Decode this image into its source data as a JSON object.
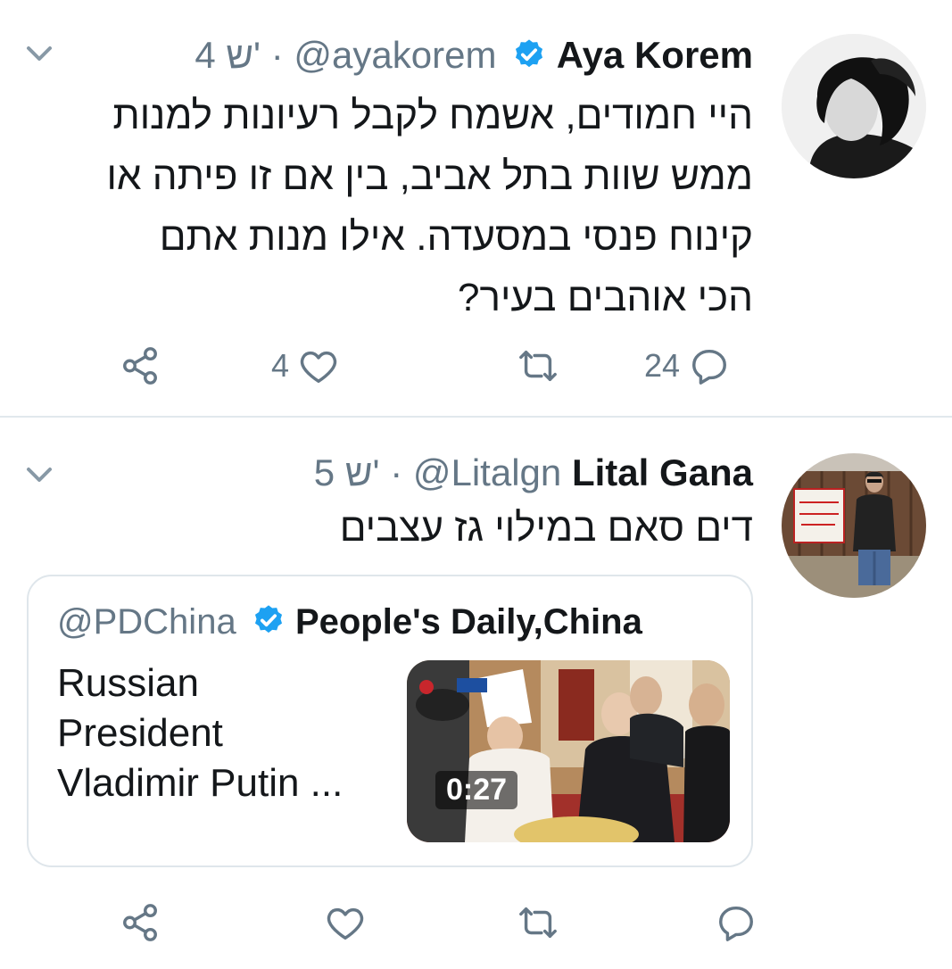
{
  "tweets": [
    {
      "name": "Aya Korem",
      "handle": "@ayakorem",
      "dot": "·",
      "time": "4 ש'",
      "text_lines": [
        "היי חמודים, אשמח לקבל רעיונות למנות",
        "ממש שוות בתל אביב, בין אם זו פיתה או",
        "קינוח פנסי במסעדה. אילו מנות אתם",
        "הכי אוהבים בעיר?"
      ],
      "reply_count": "24",
      "retweet_count": "",
      "like_count": "4"
    },
    {
      "name": "Lital Gana",
      "handle": "@Litalgn",
      "dot": "·",
      "time": "5 ש'",
      "text_lines": [
        "דים סאם במילוי גז עצבים"
      ],
      "quote": {
        "name": "People's Daily,China",
        "handle": "@PDChina",
        "text_lines": [
          "Russian",
          "President",
          "Vladimir Putin ..."
        ],
        "duration": "0:27"
      },
      "reply_count": "",
      "retweet_count": "",
      "like_count": ""
    }
  ],
  "colors": {
    "verified": "#1da1f2",
    "secondary": "#657786",
    "border": "#e1e8ed"
  },
  "icons": [
    "chevron-down-icon",
    "verified-badge-icon",
    "reply-icon",
    "retweet-icon",
    "like-icon",
    "share-icon",
    "play-video-thumbnail"
  ]
}
